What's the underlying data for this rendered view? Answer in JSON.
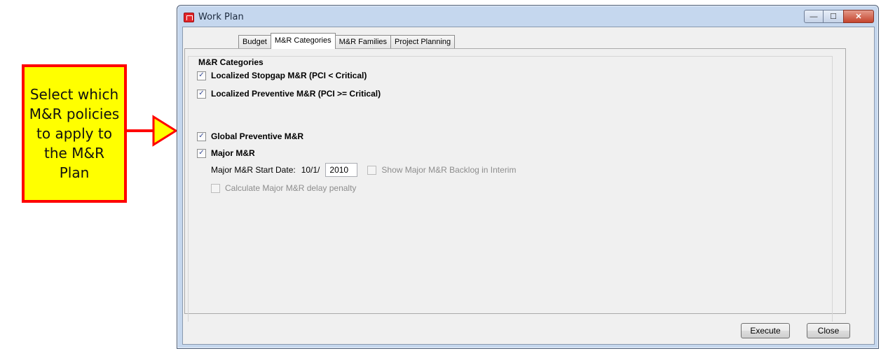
{
  "callout": {
    "text": "Select which M&R policies to apply to the M&R Plan"
  },
  "window": {
    "title": "Work Plan",
    "controls": {
      "minimize": "—",
      "maximize": "☐",
      "close": "✕"
    }
  },
  "tabs": [
    {
      "label": "Budget"
    },
    {
      "label": "M&R Categories"
    },
    {
      "label": "M&R Families"
    },
    {
      "label": "Project Planning"
    }
  ],
  "active_tab": "M&R Categories",
  "group": {
    "legend": "M&R Categories"
  },
  "options": {
    "stopgap": {
      "label": "Localized Stopgap M&R (PCI < Critical)",
      "checked": true
    },
    "preventive": {
      "label": "Localized Preventive M&R (PCI >= Critical)",
      "checked": true
    },
    "global": {
      "label": "Global Preventive M&R",
      "checked": true
    },
    "major": {
      "label": "Major M&R",
      "checked": true
    }
  },
  "major": {
    "start_date_label": "Major M&R Start Date:",
    "start_date_prefix": "10/1/",
    "start_year": "2010",
    "backlog_label": "Show Major M&R Backlog in Interim",
    "penalty_label": "Calculate Major M&R delay penalty"
  },
  "buttons": {
    "execute": "Execute",
    "close": "Close"
  },
  "check_glyph": "✓",
  "colors": {
    "callout_bg": "#ffff00",
    "callout_border": "#ff0000",
    "window_frame": "#c5d7ee",
    "close_button": "#c5452d"
  }
}
